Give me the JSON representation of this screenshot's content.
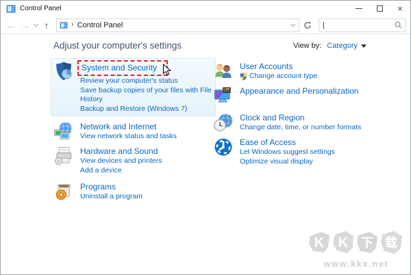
{
  "titlebar": {
    "title": "Control Panel"
  },
  "navbar": {
    "breadcrumb_root": "Control Panel",
    "breadcrumb_separator": "›",
    "search_caret": "|"
  },
  "header": {
    "title": "Adjust your computer's settings",
    "view_by_label": "View by:",
    "view_by_value": "Category"
  },
  "categories": {
    "left": [
      {
        "title": "System and Security",
        "icon": "security-shield-icon",
        "highlighted": true,
        "links": [
          "Review your computer's status",
          "Save backup copies of your files with File History",
          "Backup and Restore (Windows 7)"
        ]
      },
      {
        "title": "Network and Internet",
        "icon": "network-icon",
        "links": [
          "View network status and tasks"
        ]
      },
      {
        "title": "Hardware and Sound",
        "icon": "printer-icon",
        "links": [
          "View devices and printers",
          "Add a device"
        ]
      },
      {
        "title": "Programs",
        "icon": "programs-box-icon",
        "links": [
          "Uninstall a program"
        ]
      }
    ],
    "right": [
      {
        "title": "User Accounts",
        "icon": "user-accounts-icon",
        "links": [
          "Change account type"
        ]
      },
      {
        "title": "Appearance and Personalization",
        "icon": "appearance-icon",
        "links": []
      },
      {
        "title": "Clock and Region",
        "icon": "clock-region-icon",
        "links": [
          "Change date, time, or number formats"
        ]
      },
      {
        "title": "Ease of Access",
        "icon": "ease-of-access-icon",
        "links": [
          "Let Windows suggest settings",
          "Optimize visual display"
        ]
      }
    ]
  },
  "watermark": {
    "text": "KK下载",
    "chars": [
      "K",
      "K",
      "下",
      "载"
    ],
    "site": "www.kkx.net"
  },
  "colors": {
    "link_blue": "#0a66c2",
    "page_title": "#41536e",
    "highlight_bg": "#e9f4fb",
    "selection_dashed_red": "#ee1c23"
  }
}
